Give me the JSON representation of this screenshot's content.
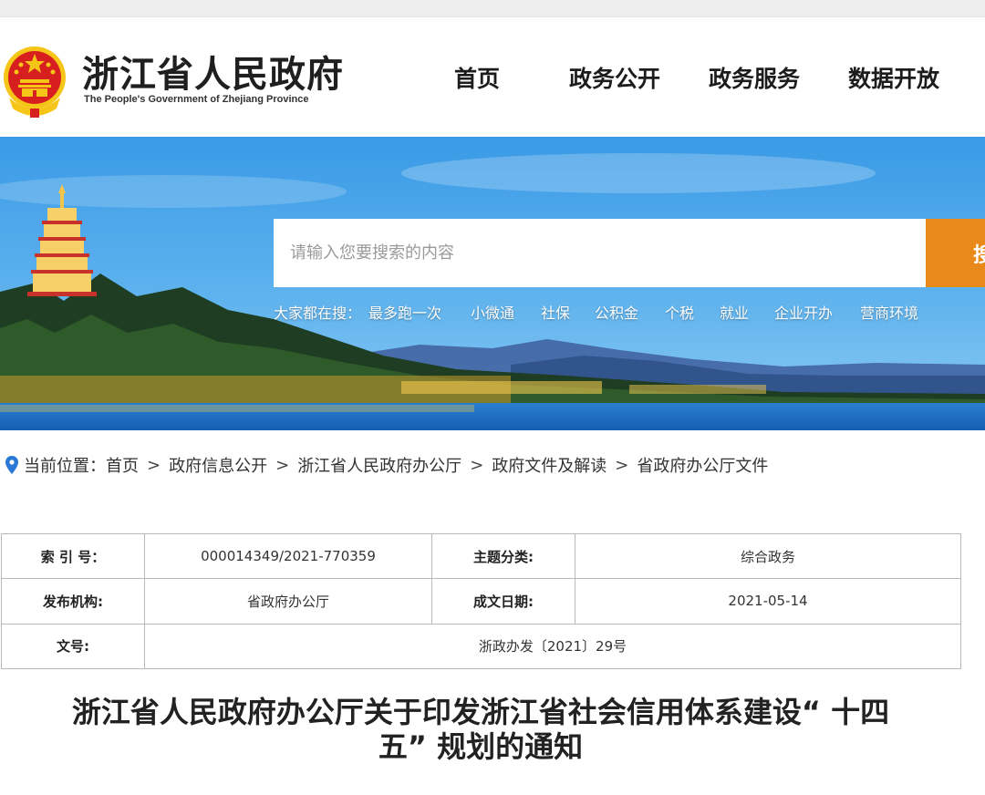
{
  "header": {
    "site_title": "浙江省人民政府",
    "site_subtitle": "The People's Government of Zhejiang Province",
    "nav": [
      {
        "label": "首页"
      },
      {
        "label": "政务公开"
      },
      {
        "label": "政务服务"
      },
      {
        "label": "数据开放"
      }
    ]
  },
  "search": {
    "placeholder": "请输入您要搜索的内容",
    "button_label": "搜"
  },
  "hot_search": {
    "prefix": "大家都在搜：",
    "items": [
      "最多跑一次",
      "小微通",
      "社保",
      "公积金",
      "个税",
      "就业",
      "企业开办",
      "营商环境"
    ]
  },
  "breadcrumb": {
    "prefix": "当前位置：",
    "items": [
      "首页",
      "政府信息公开",
      "浙江省人民政府办公厅",
      "政府文件及解读",
      "省政府办公厅文件"
    ],
    "separator": ">"
  },
  "meta_table": {
    "index_label": "索 引 号：",
    "index_value": "000014349/2021-770359",
    "topic_label": "主题分类:",
    "topic_value": "综合政务",
    "publisher_label": "发布机构:",
    "publisher_value": "省政府办公厅",
    "date_label": "成文日期:",
    "date_value": "2021-05-14",
    "docno_label": "文号:",
    "docno_value": "浙政办发〔2021〕29号"
  },
  "document": {
    "title_line1": "浙江省人民政府办公厅关于印发浙江省社会信用体系建设“ 十四",
    "title_line2": "五” 规划的通知"
  },
  "colors": {
    "accent_orange": "#e8891a",
    "emblem_red": "#d71f1f",
    "emblem_gold": "#f5c518",
    "sky_blue": "#2f8fd8",
    "lake_blue": "#1b6fc4"
  }
}
